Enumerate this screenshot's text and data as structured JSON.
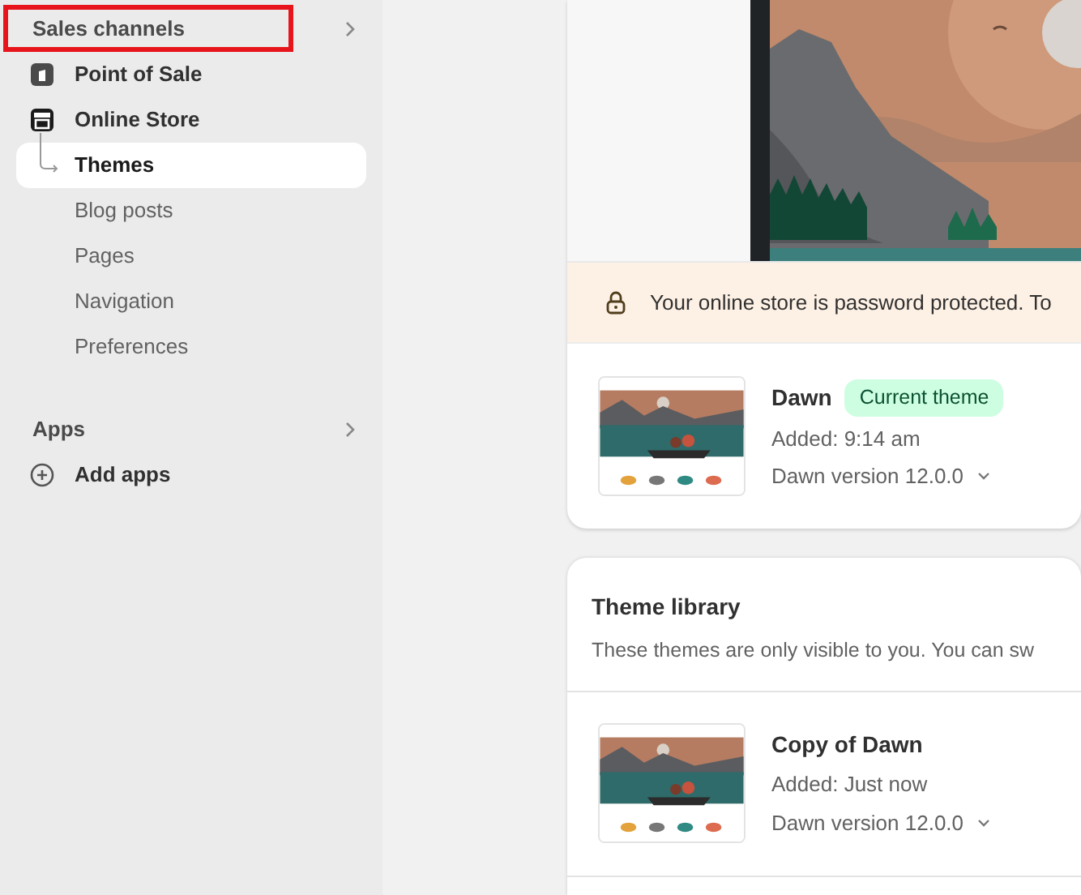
{
  "sidebar": {
    "sections": [
      {
        "title": "Sales channels",
        "highlighted": true,
        "items": [
          {
            "label": "Point of Sale",
            "kind": "pos",
            "selected": false
          },
          {
            "label": "Online Store",
            "kind": "store",
            "selected": false
          },
          {
            "label": "Themes",
            "kind": "sub",
            "selected": true
          },
          {
            "label": "Blog posts",
            "kind": "page",
            "selected": false
          },
          {
            "label": "Pages",
            "kind": "page",
            "selected": false
          },
          {
            "label": "Navigation",
            "kind": "page",
            "selected": false
          },
          {
            "label": "Preferences",
            "kind": "page",
            "selected": false
          }
        ]
      },
      {
        "title": "Apps",
        "highlighted": false,
        "items": [
          {
            "label": "Add apps",
            "kind": "add",
            "selected": false
          }
        ]
      }
    ]
  },
  "current_theme": {
    "banner": "Your online store is password protected. To",
    "theme": {
      "name": "Dawn",
      "badge": "Current theme",
      "added": "Added: 9:14 am",
      "version": "Dawn version 12.0.0"
    }
  },
  "theme_library": {
    "title": "Theme library",
    "description": "These themes are only visible to you. You can sw",
    "themes": [
      {
        "name": "Copy of Dawn",
        "added": "Added: Just now",
        "version": "Dawn version 12.0.0"
      }
    ]
  }
}
